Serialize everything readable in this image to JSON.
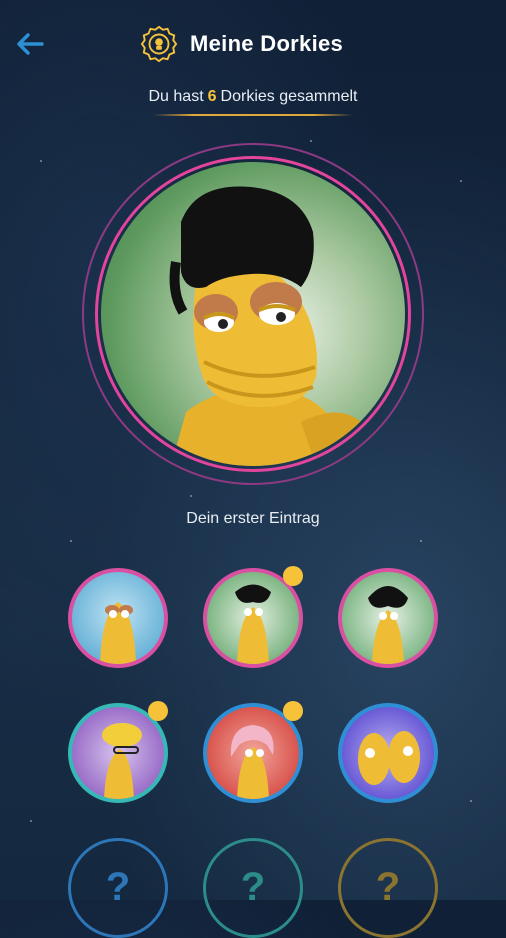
{
  "header": {
    "back_icon": "arrow-left-icon",
    "badge_icon": "dorkie-badge-icon",
    "title": "Meine Dorkies"
  },
  "summary": {
    "prefix": "Du hast",
    "count": "6",
    "suffix": "Dorkies gesammelt"
  },
  "featured": {
    "caption": "Dein erster Eintrag"
  },
  "collection": {
    "items": [
      {
        "name": "dorkie-1",
        "new": false,
        "ring": "#d94fa1",
        "bg": "#6cb4d8"
      },
      {
        "name": "dorkie-2",
        "new": true,
        "ring": "#d94fa1",
        "bg": "#7fb685"
      },
      {
        "name": "dorkie-3",
        "new": false,
        "ring": "#d94fa1",
        "bg": "#82b98a"
      },
      {
        "name": "dorkie-4",
        "new": true,
        "ring": "#36b9b6",
        "bg": "#9b6fc9"
      },
      {
        "name": "dorkie-5",
        "new": true,
        "ring": "#2f8fd4",
        "bg": "#d9564f"
      },
      {
        "name": "dorkie-6",
        "new": false,
        "ring": "#2f8fd4",
        "bg": "#6a5bd6"
      }
    ],
    "locked": [
      {
        "symbol": "?",
        "color": "#2d76b8"
      },
      {
        "symbol": "?",
        "color": "#2b8c89"
      },
      {
        "symbol": "?",
        "color": "#8a7430"
      }
    ]
  },
  "colors": {
    "accent": "#2f8fd4",
    "highlight": "#f6c23a",
    "hero_ring": "#e2459b"
  }
}
